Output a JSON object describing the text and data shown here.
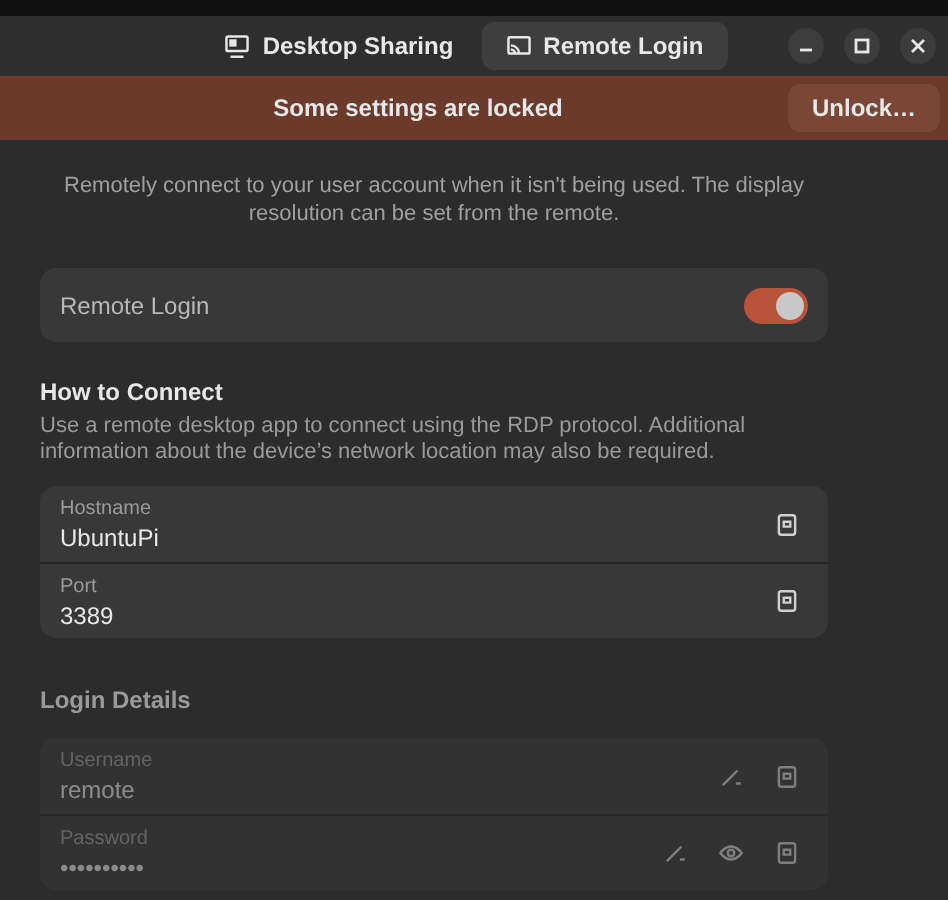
{
  "tabs": [
    {
      "label": "Desktop Sharing",
      "selected": false,
      "kind": "monitor"
    },
    {
      "label": "Remote Login",
      "selected": true,
      "kind": "cast"
    }
  ],
  "banner": {
    "text": "Some settings are locked",
    "button": "Unlock…"
  },
  "description": "Remotely connect to your user account when it isn't being used. The display resolution can be set from the remote.",
  "remote_login": {
    "label": "Remote Login",
    "on": true
  },
  "how_to_connect": {
    "title": "How to Connect",
    "text": "Use a remote desktop app to connect using the RDP protocol. Additional information about the device’s network location may also be required.",
    "fields": [
      {
        "label": "Hostname",
        "value": "UbuntuPi",
        "actions": [
          {
            "kind": "copy"
          }
        ]
      },
      {
        "label": "Port",
        "value": "3389",
        "actions": [
          {
            "kind": "copy"
          }
        ]
      }
    ]
  },
  "login_details": {
    "title": "Login Details",
    "disabled": true,
    "fields": [
      {
        "label": "Username",
        "value": "remote",
        "actions": [
          {
            "kind": "edit"
          },
          {
            "kind": "copy"
          }
        ]
      },
      {
        "label": "Password",
        "value": "••••••••••",
        "actions": [
          {
            "kind": "edit"
          },
          {
            "kind": "reveal"
          },
          {
            "kind": "copy"
          }
        ]
      }
    ]
  }
}
